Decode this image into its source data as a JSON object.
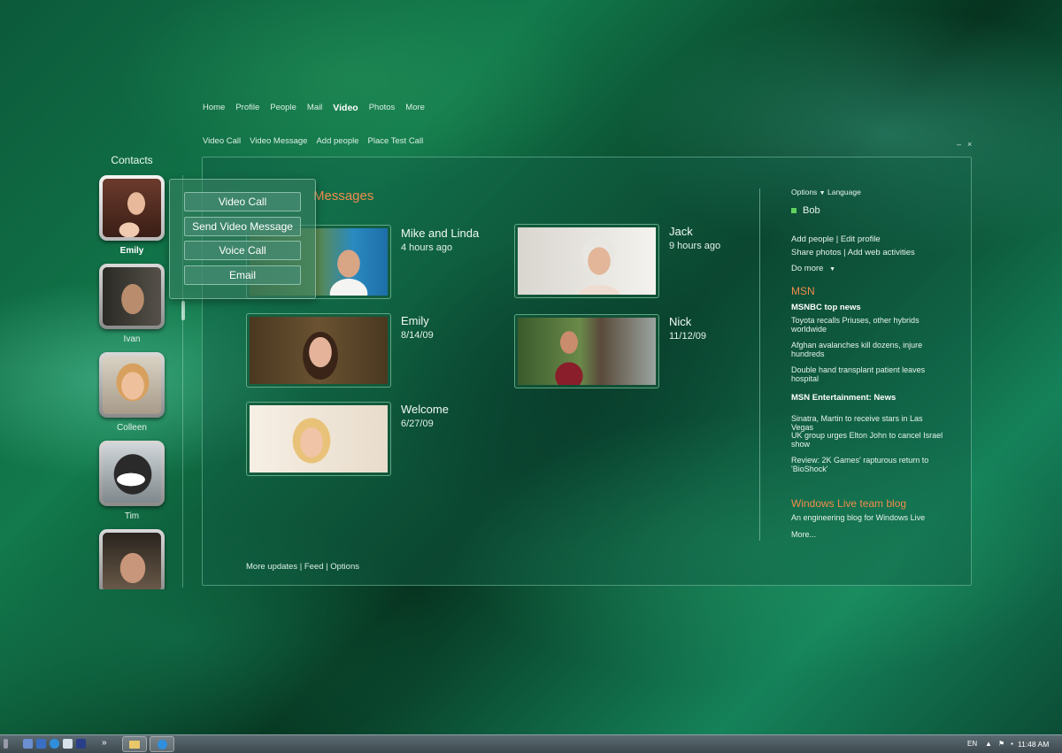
{
  "nav": {
    "tabs": [
      "Home",
      "Profile",
      "People",
      "Mail",
      "Video",
      "Photos",
      "More"
    ],
    "active": "Video",
    "actions": [
      "Video Call",
      "Video Message",
      "Add people",
      "Place Test Call"
    ],
    "minimize_glyph": "–",
    "close_glyph": "×"
  },
  "contacts": {
    "title": "Contacts",
    "items": [
      {
        "name": "Emily"
      },
      {
        "name": "Ivan"
      },
      {
        "name": "Colleen"
      },
      {
        "name": "Tim"
      },
      {
        "name": ""
      }
    ]
  },
  "popup": {
    "video_call": "Video Call",
    "send_video_message": "Send Video Message",
    "voice_call": "Voice Call",
    "email": "Email"
  },
  "main": {
    "title": "Messages",
    "messages": [
      {
        "name": "Mike and Linda",
        "date": "4 hours ago"
      },
      {
        "name": "Jack",
        "date": "9 hours ago"
      },
      {
        "name": "Emily",
        "date": "8/14/09"
      },
      {
        "name": "Nick",
        "date": "11/12/09"
      },
      {
        "name": "Welcome",
        "date": "6/27/09"
      }
    ],
    "footer": {
      "updates": "More updates",
      "sep1": " | ",
      "feed": "Feed",
      "sep2": " | ",
      "options": "Options"
    }
  },
  "sidebar": {
    "options": "Options",
    "language": "Language",
    "user": "Bob",
    "add_people": "Add people",
    "edit_profile": "Edit profile",
    "share_photos": "Share photos",
    "add_web_activities": "Add web activities",
    "do_more": "Do more",
    "msn_title": "MSN",
    "msnbc_title": "MSNBC top news",
    "msnbc_news": [
      "Toyota recalls Priuses, other hybrids worldwide",
      "Afghan avalanches kill dozens, injure hundreds",
      "Double hand transplant patient leaves hospital"
    ],
    "ent_title": "MSN Entertainment: News",
    "ent_news": [
      "Sinatra, Martin to receive stars in Las Vegas",
      "UK group urges Elton John to cancel Israel show",
      "Review: 2K Games' rapturous return to 'BioShock'"
    ],
    "blog_title": "Windows Live team blog",
    "blog_desc": "An engineering blog for Windows Live",
    "more": "More..."
  },
  "taskbar": {
    "language": "EN",
    "time": "11:48 AM",
    "overflow": "»"
  },
  "colors": {
    "accent": "#f08c4c",
    "presence": "#5ed15e"
  }
}
